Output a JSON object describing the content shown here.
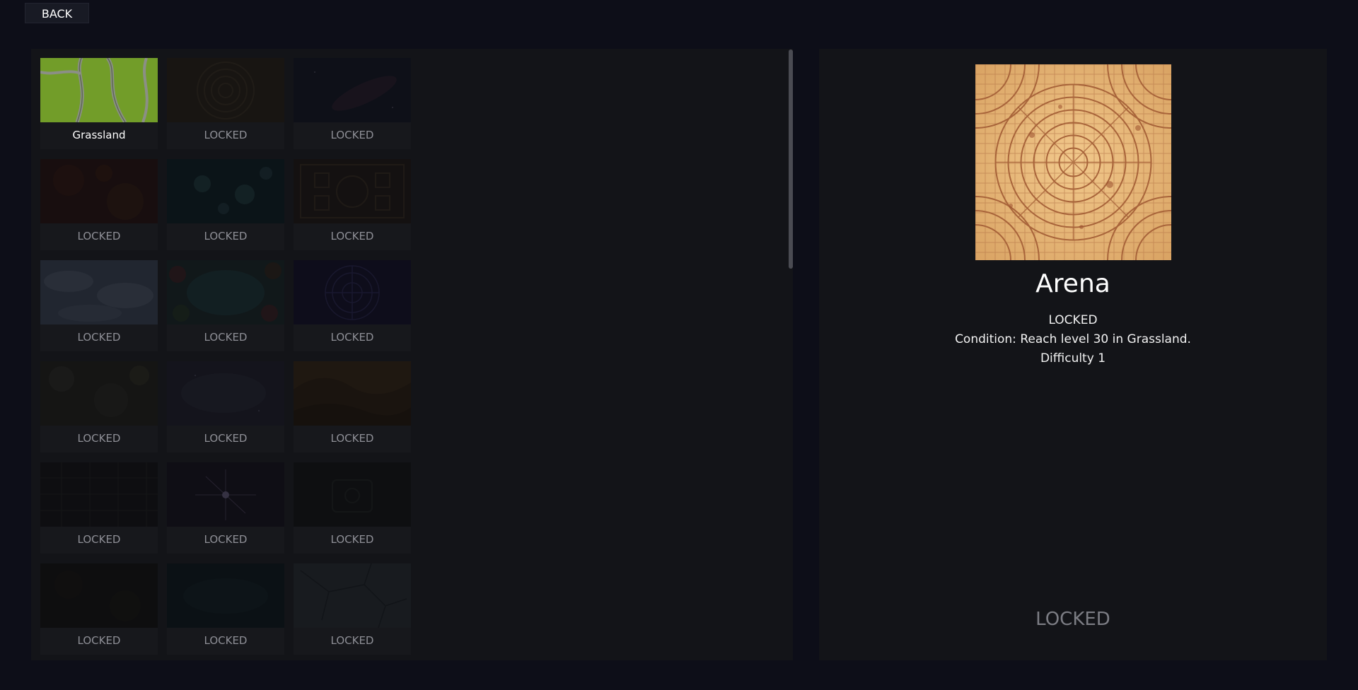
{
  "back_label": "BACK",
  "maps": [
    {
      "label": "Grassland",
      "icon": "grassland-thumbnail",
      "locked": false
    },
    {
      "label": "LOCKED",
      "icon": "arena-thumbnail",
      "locked": true
    },
    {
      "label": "LOCKED",
      "icon": "space-thumbnail",
      "locked": true
    },
    {
      "label": "LOCKED",
      "icon": "lava-thumbnail",
      "locked": true
    },
    {
      "label": "LOCKED",
      "icon": "ice-thumbnail",
      "locked": true
    },
    {
      "label": "LOCKED",
      "icon": "temple-thumbnail",
      "locked": true
    },
    {
      "label": "LOCKED",
      "icon": "clouds-thumbnail",
      "locked": true
    },
    {
      "label": "LOCKED",
      "icon": "forest-pond-thumbnail",
      "locked": true
    },
    {
      "label": "LOCKED",
      "icon": "rune-circle-thumbnail",
      "locked": true
    },
    {
      "label": "LOCKED",
      "icon": "rocky-terrain-thumbnail",
      "locked": true
    },
    {
      "label": "LOCKED",
      "icon": "nebula-thumbnail",
      "locked": true
    },
    {
      "label": "LOCKED",
      "icon": "desert-dunes-thumbnail",
      "locked": true
    },
    {
      "label": "LOCKED",
      "icon": "dark-tiles-thumbnail",
      "locked": true
    },
    {
      "label": "LOCKED",
      "icon": "starburst-thumbnail",
      "locked": true
    },
    {
      "label": "LOCKED",
      "icon": "dungeon-thumbnail",
      "locked": true
    },
    {
      "label": "LOCKED",
      "icon": "dark-soil-thumbnail",
      "locked": true
    },
    {
      "label": "LOCKED",
      "icon": "deep-water-thumbnail",
      "locked": true
    },
    {
      "label": "LOCKED",
      "icon": "cracked-stone-thumbnail",
      "locked": true
    }
  ],
  "detail": {
    "title": "Arena",
    "status": "LOCKED",
    "condition": "Condition: Reach level 30 in Grassland.",
    "difficulty": "Difficulty 1",
    "action_label": "LOCKED",
    "image_icon": "arena-floor-image"
  },
  "colors": {
    "background": "#0d0e18",
    "panel": "#131418",
    "tile": "#17181c",
    "locked_text": "#8e8f96",
    "title_text": "#ffffff"
  }
}
